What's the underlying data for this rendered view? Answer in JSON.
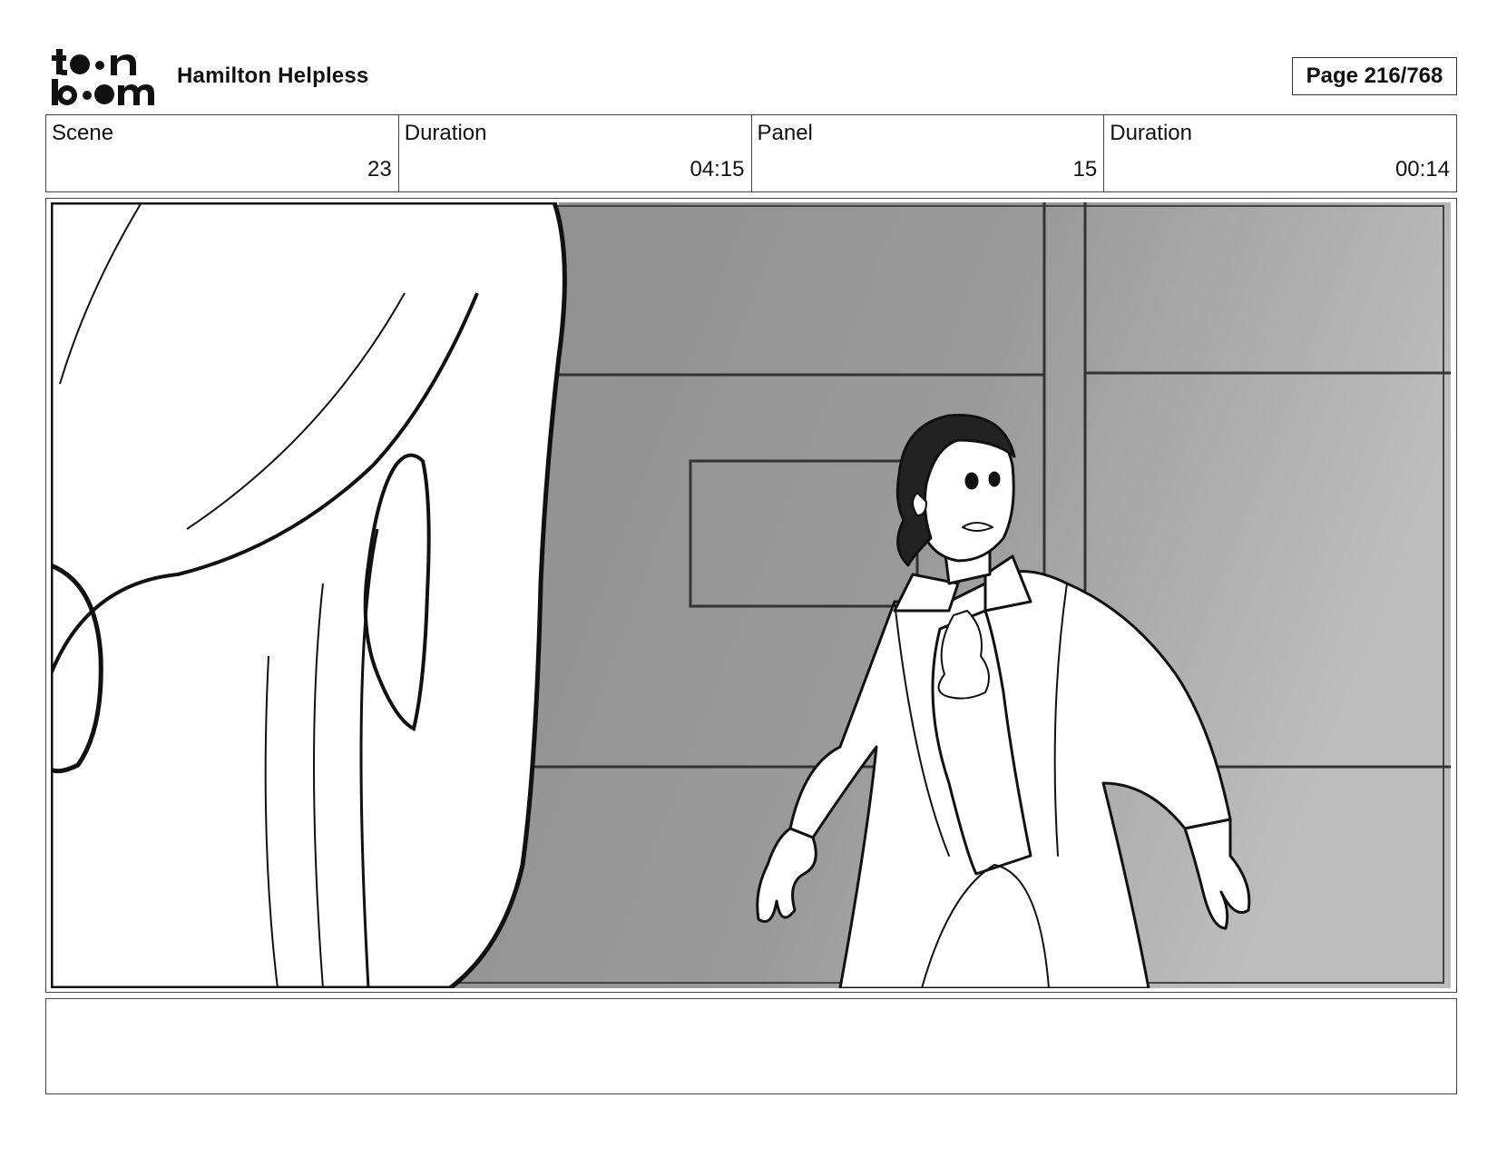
{
  "header": {
    "logo_text": "toonboom",
    "project_title": "Hamilton Helpless",
    "page_label": "Page 216/768"
  },
  "info": [
    {
      "label": "Scene",
      "value": "23"
    },
    {
      "label": "Duration",
      "value": "04:15"
    },
    {
      "label": "Panel",
      "value": "15"
    },
    {
      "label": "Duration",
      "value": "00:14"
    }
  ],
  "panel": {
    "description": "storyboard-sketch"
  },
  "notes": {
    "text": ""
  }
}
